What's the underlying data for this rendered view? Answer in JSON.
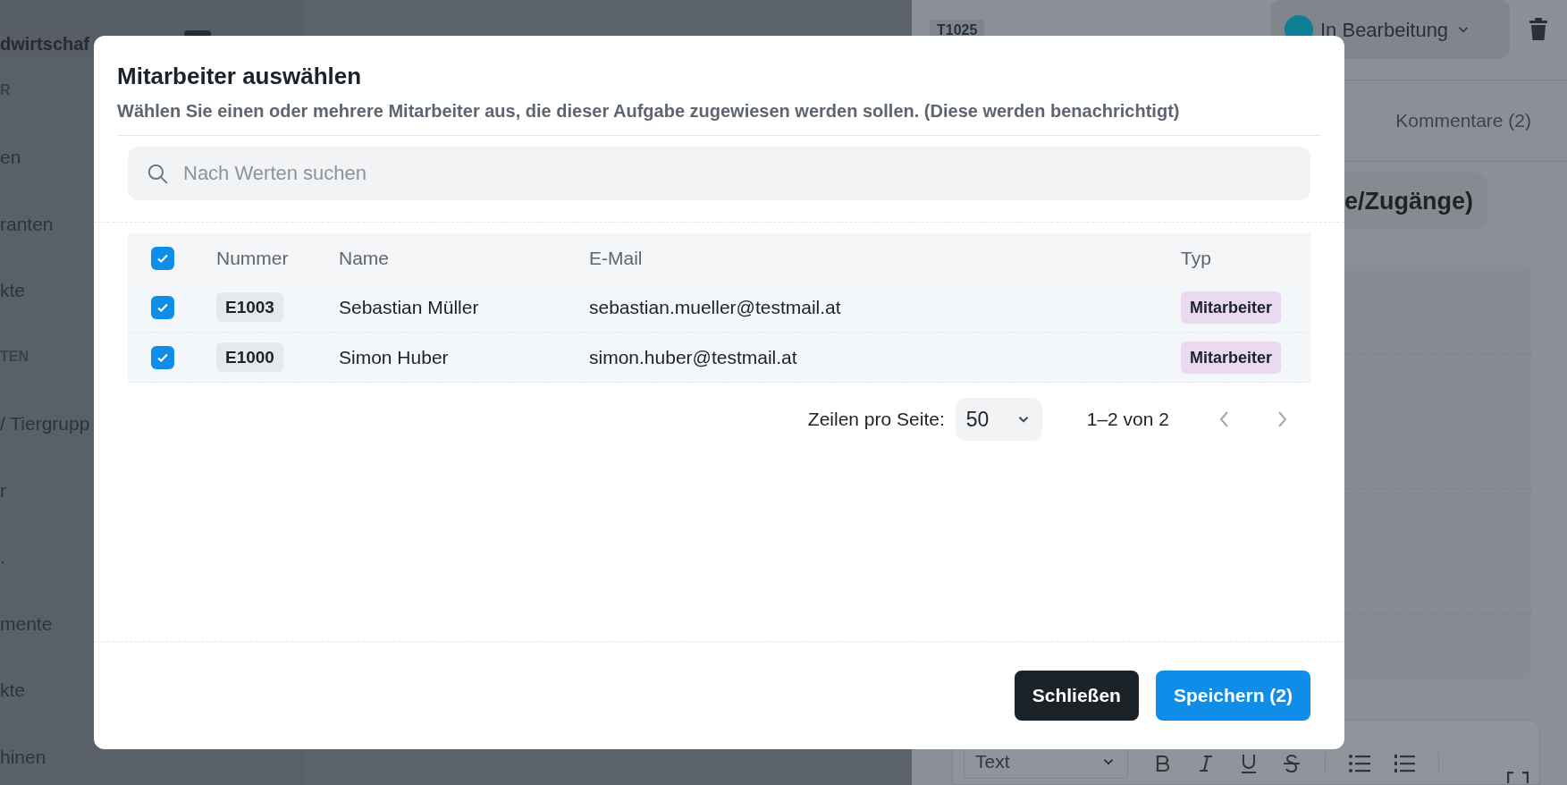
{
  "background": {
    "sidebar": {
      "title": "dwirtschaf",
      "items": [
        {
          "kind": "section",
          "label": "R"
        },
        {
          "kind": "link",
          "label": "en"
        },
        {
          "kind": "link",
          "label": "ranten"
        },
        {
          "kind": "link",
          "label": "kte"
        },
        {
          "kind": "section",
          "label": "TEN"
        },
        {
          "kind": "link",
          "label": "/ Tiergrupp"
        },
        {
          "kind": "link",
          "label": "r"
        },
        {
          "kind": "link",
          "label": "."
        },
        {
          "kind": "link",
          "label": "mente"
        },
        {
          "kind": "link",
          "label": "kte"
        },
        {
          "kind": "link",
          "label": "hinen"
        }
      ]
    },
    "panel": {
      "ticket": "T1025",
      "status": "In Bearbeitung",
      "tab": "Kommentare (2)",
      "heading": "e/Zugänge)",
      "editor": {
        "format": "Text"
      }
    }
  },
  "dialog": {
    "title": "Mitarbeiter auswählen",
    "description": "Wählen Sie einen oder mehrere Mitarbeiter aus, die dieser Aufgabe zugewiesen werden sollen. (Diese werden benachrichtigt)",
    "search": {
      "placeholder": "Nach Werten suchen"
    },
    "table": {
      "select_all": {
        "checked": true
      },
      "columns": [
        "Nummer",
        "Name",
        "E-Mail",
        "Typ"
      ],
      "rows": [
        {
          "checked": true,
          "number": "E1003",
          "name": "Sebastian Müller",
          "email": "sebastian.mueller@testmail.at",
          "type": "Mitarbeiter"
        },
        {
          "checked": true,
          "number": "E1000",
          "name": "Simon Huber",
          "email": "simon.huber@testmail.at",
          "type": "Mitarbeiter"
        }
      ]
    },
    "pagination": {
      "rows_per_page_label": "Zeilen pro Seite:",
      "rows_per_page": "50",
      "range": "1–2 von 2"
    },
    "buttons": [
      {
        "kind": "secondary",
        "label": "Schließen"
      },
      {
        "kind": "primary",
        "label": "Speichern (2)"
      }
    ]
  }
}
